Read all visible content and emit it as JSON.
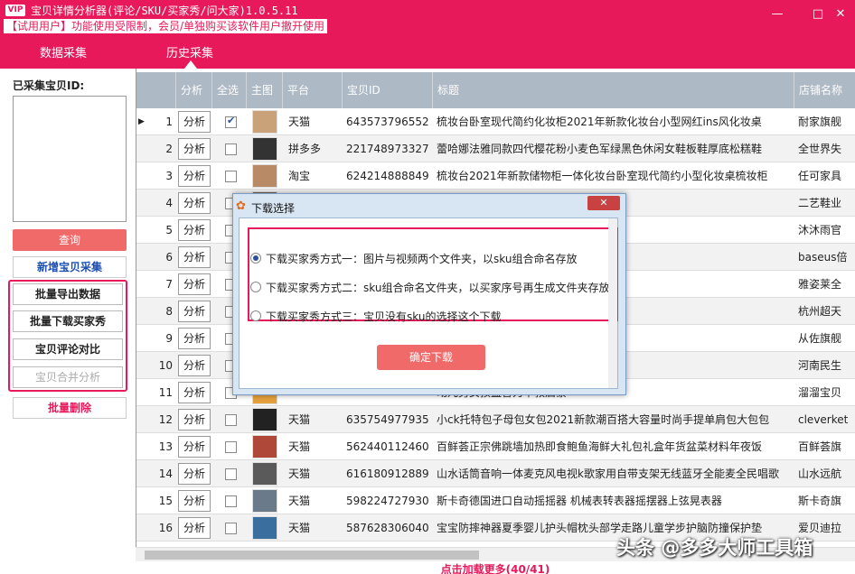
{
  "window": {
    "badge": "VIP",
    "title": "宝贝详情分析器(评论/SKU/买家秀/问大家)1.0.5.11",
    "trial_notice": "【试用用户】功能使用受限制，会员/单独购买该软件用户撤开使用",
    "minimize": "—",
    "maximize": "□",
    "close": "✕"
  },
  "nav": {
    "tabs": [
      "数据采集",
      "历史采集"
    ],
    "active": "历史采集"
  },
  "left": {
    "ids_label": "已采集宝贝ID:",
    "query_btn": "查询",
    "new_btn": "新增宝贝采集",
    "batch_export": "批量导出数据",
    "batch_download": "批量下载买家秀",
    "review_compare": "宝贝评论对比",
    "merge_analyze": "宝贝合并分析",
    "batch_delete": "批量删除"
  },
  "table": {
    "headers": [
      "分析",
      "全选",
      "主图",
      "平台",
      "宝贝ID",
      "标题",
      "店铺名称"
    ],
    "analyze_label": "分析",
    "rows": [
      {
        "n": "1",
        "checked": true,
        "platform": "天猫",
        "id": "643573796552",
        "title": "梳妆台卧室现代简约化妆柜2021年新款化妆台小型网红ins风化妆桌",
        "shop": "耐家旗舰"
      },
      {
        "n": "2",
        "checked": false,
        "platform": "拼多多",
        "id": "221748973327",
        "title": "蕾哈娜法雅同款四代樱花粉小麦色军绿黑色休闲女鞋板鞋厚底松糕鞋",
        "shop": "全世界失"
      },
      {
        "n": "3",
        "checked": false,
        "platform": "淘宝",
        "id": "624214888849",
        "title": "梳妆台2021年新款储物柜一体化妆台卧室现代简约小型化妆桌梳妆柜",
        "shop": "任可家具"
      },
      {
        "n": "4",
        "checked": false,
        "platform": "",
        "id": "",
        "title": "生宿舍踩屎感网红ins凉鞋",
        "shop": "二艺鞋业"
      },
      {
        "n": "5",
        "checked": false,
        "platform": "",
        "id": "",
        "title": "动淋浴花洒便携式充电花洒",
        "shop": "沐沐雨官"
      },
      {
        "n": "6",
        "checked": false,
        "platform": "",
        "id": "",
        "title": "点烟器转换插头100W车充",
        "shop": "baseus倍"
      },
      {
        "n": "7",
        "checked": false,
        "platform": "",
        "id": "",
        "title": "不脱妆持久定型官方正品",
        "shop": "雅姿莱全"
      },
      {
        "n": "8",
        "checked": false,
        "platform": "",
        "id": "",
        "title": "电瓶车电动车充电站充电桩",
        "shop": "杭州超天"
      },
      {
        "n": "9",
        "checked": false,
        "platform": "",
        "id": "",
        "title": "马尾帽韩版百搭防晒帽子女",
        "shop": "从佐旗舰"
      },
      {
        "n": "10",
        "checked": false,
        "platform": "",
        "id": "",
        "title": "薄男用情趣黄金正品旗舰店",
        "shop": "河南民生"
      },
      {
        "n": "11",
        "checked": false,
        "platform": "",
        "id": "",
        "title": "动儿男女孩益智力早教启蒙",
        "shop": "溜溜宝贝"
      },
      {
        "n": "12",
        "checked": false,
        "platform": "天猫",
        "id": "635754977935",
        "title": "小ck托特包子母包女包2021新款潮百搭大容量时尚手提单肩包大包包",
        "shop": "cleverket"
      },
      {
        "n": "13",
        "checked": false,
        "platform": "天猫",
        "id": "562440112460",
        "title": "百鲜荟正宗佛跳墙加热即食鲍鱼海鲜大礼包礼盒年货盆菜材料年夜饭",
        "shop": "百鲜荟旗"
      },
      {
        "n": "14",
        "checked": false,
        "platform": "天猫",
        "id": "616180912889",
        "title": "山水话筒音响一体麦克风电视k歌家用自带支架无线蓝牙全能麦全民唱歌",
        "shop": "山水远航"
      },
      {
        "n": "15",
        "checked": false,
        "platform": "天猫",
        "id": "598224727930",
        "title": "斯卡奇德国进口自动摇摇器 机械表转表器摇摆器上弦晃表器",
        "shop": "斯卡奇旗"
      },
      {
        "n": "16",
        "checked": false,
        "platform": "天猫",
        "id": "587628306040",
        "title": "宝宝防摔神器夏季婴儿护头帽枕头部学走路儿童学步护脑防撞保护垫",
        "shop": "爱贝迪拉"
      }
    ]
  },
  "load_more": "点击加载更多(40/41)",
  "dialog": {
    "title": "下载选择",
    "close": "✕",
    "options": [
      "下载买家秀方式一：图片与视频两个文件夹，以sku组合命名存放",
      "下载买家秀方式二：sku组合命名文件夹，以买家序号再生成文件夹存放",
      "下载买家秀方式三：宝贝没有sku的选择这个下载"
    ],
    "selected": 0,
    "confirm": "确定下载"
  },
  "watermark": "头条 @多多大师工具箱",
  "colors": {
    "brand": "#e8195a",
    "button_red": "#f06a6a",
    "header_gray": "#aeb9c6",
    "link_blue": "#1a4fb0"
  }
}
